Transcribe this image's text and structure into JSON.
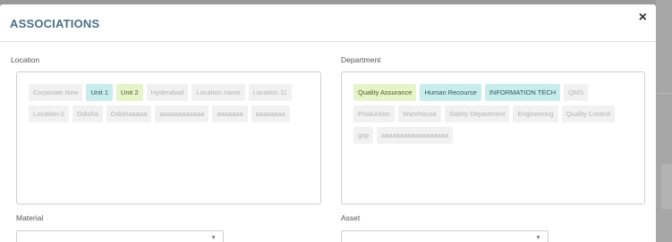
{
  "modal": {
    "title": "ASSOCIATIONS",
    "close_label": "×"
  },
  "location": {
    "label": "Location",
    "tags": [
      {
        "text": "Corporate New",
        "state": "normal"
      },
      {
        "text": "Unit 1",
        "state": "selected-blue"
      },
      {
        "text": "Unit 2",
        "state": "selected-green"
      },
      {
        "text": "Hyderabad",
        "state": "normal"
      },
      {
        "text": "Location name",
        "state": "normal"
      },
      {
        "text": "Location 11",
        "state": "normal"
      },
      {
        "text": "Location-2",
        "state": "normal"
      },
      {
        "text": "Odisha",
        "state": "normal"
      },
      {
        "text": "Odishaaaaa",
        "state": "normal"
      },
      {
        "text": "aaaaaaaaaaaa",
        "state": "normal"
      },
      {
        "text": "aaaaaaa",
        "state": "normal"
      },
      {
        "text": "aaaaaaaa",
        "state": "normal"
      }
    ]
  },
  "department": {
    "label": "Department",
    "tags": [
      {
        "text": "Quality Assurance",
        "state": "selected-green"
      },
      {
        "text": "Human Recourse",
        "state": "selected-blue"
      },
      {
        "text": "INFORMATION TECH",
        "state": "selected-blue"
      },
      {
        "text": "QMS",
        "state": "normal"
      },
      {
        "text": "Production",
        "state": "normal"
      },
      {
        "text": "Warehouse",
        "state": "normal"
      },
      {
        "text": "Safety Department",
        "state": "normal"
      },
      {
        "text": "Engineering",
        "state": "normal"
      },
      {
        "text": "Quality Control",
        "state": "normal"
      },
      {
        "text": "gxp",
        "state": "normal"
      },
      {
        "text": "aaaaaaaaaaaaaaaaaa",
        "state": "normal"
      }
    ]
  },
  "material": {
    "label": "Material",
    "value": ""
  },
  "asset": {
    "label": "Asset",
    "value": ""
  },
  "colors": {
    "title": "#4a6f88",
    "selected_green": "#e7f4c9",
    "selected_blue": "#c9ecec",
    "tag_normal": "#f1f1f1"
  }
}
